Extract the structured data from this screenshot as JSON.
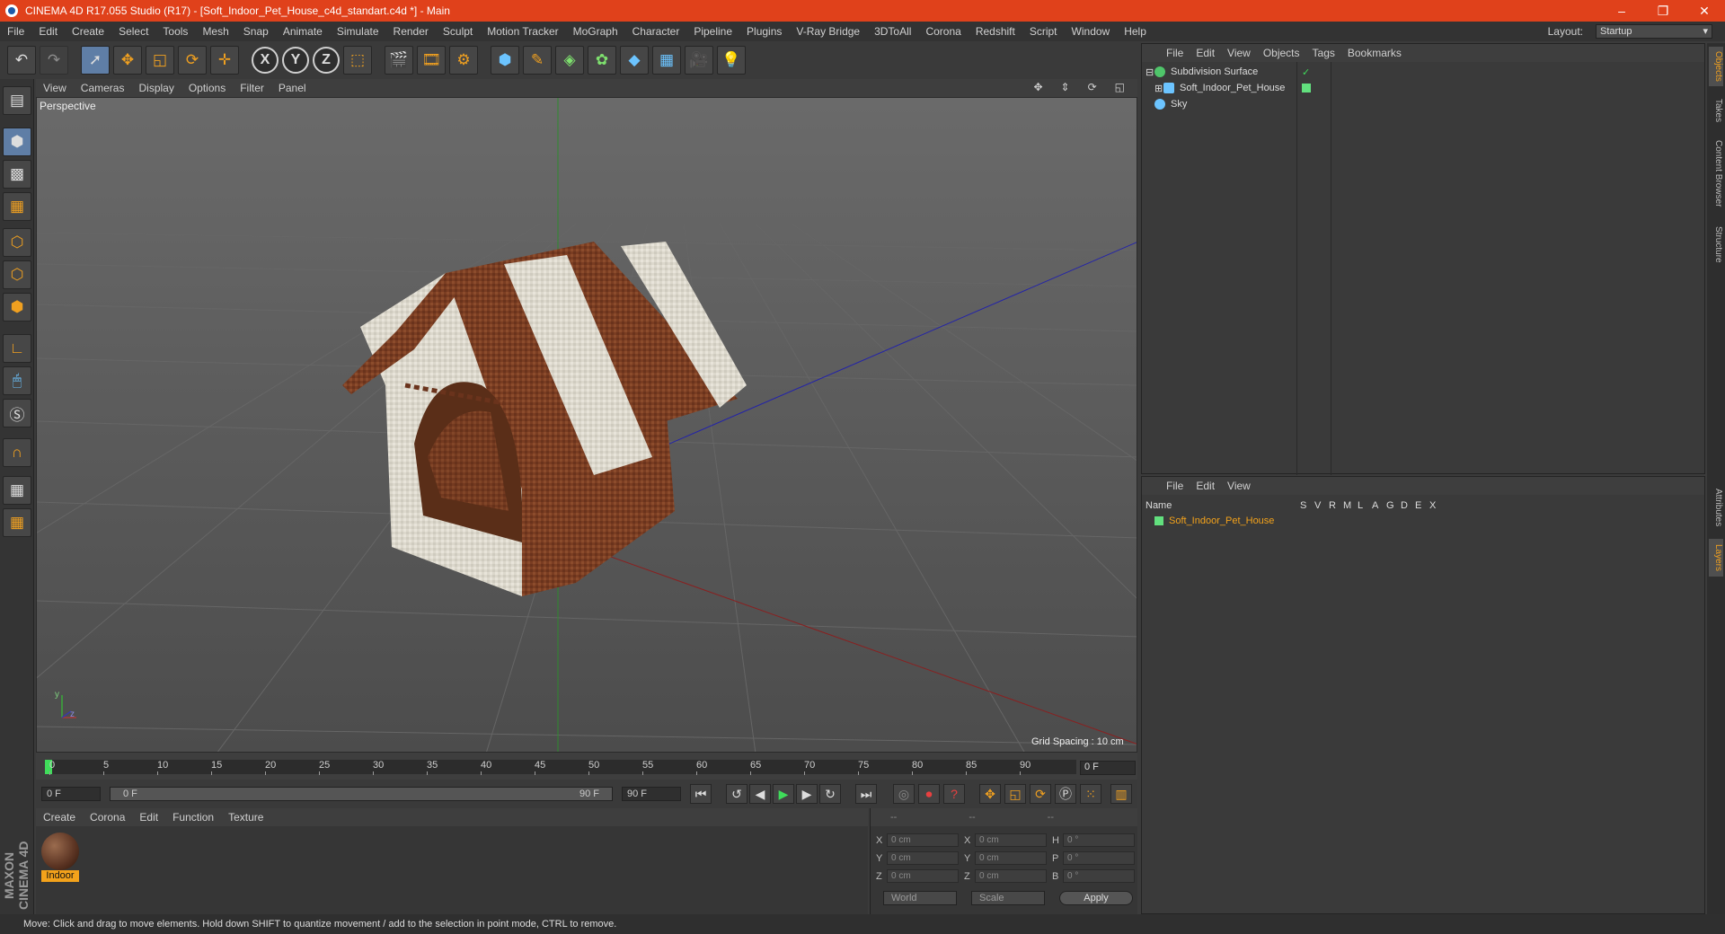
{
  "titlebar": {
    "title": "CINEMA 4D R17.055 Studio (R17) - [Soft_Indoor_Pet_House_c4d_standart.c4d *] - Main",
    "minimize": "–",
    "restore": "❐",
    "close": "✕"
  },
  "menu": [
    "File",
    "Edit",
    "Create",
    "Select",
    "Tools",
    "Mesh",
    "Snap",
    "Animate",
    "Simulate",
    "Render",
    "Sculpt",
    "Motion Tracker",
    "MoGraph",
    "Character",
    "Pipeline",
    "Plugins",
    "V-Ray Bridge",
    "3DToAll",
    "Corona",
    "Redshift",
    "Script",
    "Window",
    "Help"
  ],
  "layout": {
    "label": "Layout:",
    "value": "Startup"
  },
  "toolbar": {
    "axis_x": "X",
    "axis_y": "Y",
    "axis_z": "Z"
  },
  "viewport": {
    "menu": [
      "View",
      "Cameras",
      "Display",
      "Options",
      "Filter",
      "Panel"
    ],
    "label": "Perspective",
    "grid_spacing": "Grid Spacing : 10 cm",
    "axis_y": "y",
    "axis_z": "z"
  },
  "timeline": {
    "ticks": [
      "0",
      "5",
      "10",
      "15",
      "20",
      "25",
      "30",
      "35",
      "40",
      "45",
      "50",
      "55",
      "60",
      "65",
      "70",
      "75",
      "80",
      "85",
      "90"
    ],
    "current": "0 F"
  },
  "transport": {
    "start": "0 F",
    "slider_start": "0 F",
    "slider_end": "90 F",
    "end": "90 F"
  },
  "material": {
    "menu": [
      "Create",
      "Corona",
      "Edit",
      "Function",
      "Texture"
    ],
    "name": "Indoor"
  },
  "coords": {
    "header": [
      "--",
      "--",
      "--"
    ],
    "x": "X",
    "y": "Y",
    "z": "Z",
    "x2": "X",
    "y2": "Y",
    "z2": "Z",
    "h": "H",
    "p": "P",
    "b": "B",
    "pos_x": "0 cm",
    "pos_y": "0 cm",
    "pos_z": "0 cm",
    "size_x": "0 cm",
    "size_y": "0 cm",
    "size_z": "0 cm",
    "rot_h": "0 °",
    "rot_p": "0 °",
    "rot_b": "0 °",
    "world": "World",
    "scale": "Scale",
    "apply": "Apply"
  },
  "objects": {
    "menu": [
      "File",
      "Edit",
      "View",
      "Objects",
      "Tags",
      "Bookmarks"
    ],
    "items": [
      "Subdivision Surface",
      "Soft_Indoor_Pet_House",
      "Sky"
    ]
  },
  "layers": {
    "menu": [
      "File",
      "Edit",
      "View"
    ],
    "columns": [
      "Name",
      "S",
      "V",
      "R",
      "M",
      "L",
      "A",
      "G",
      "D",
      "E",
      "X"
    ],
    "row": "Soft_Indoor_Pet_House"
  },
  "sidetabs": [
    "Objects",
    "Takes",
    "Content Browser",
    "Structure",
    "Attributes",
    "Layers"
  ],
  "status": "Move: Click and drag to move elements. Hold down SHIFT to quantize movement / add to the selection in point mode, CTRL to remove.",
  "brand": "MAXON CINEMA 4D",
  "colors": {
    "accent": "#e0411b",
    "highlight": "#f3a21b",
    "select": "#5f7ea6"
  }
}
